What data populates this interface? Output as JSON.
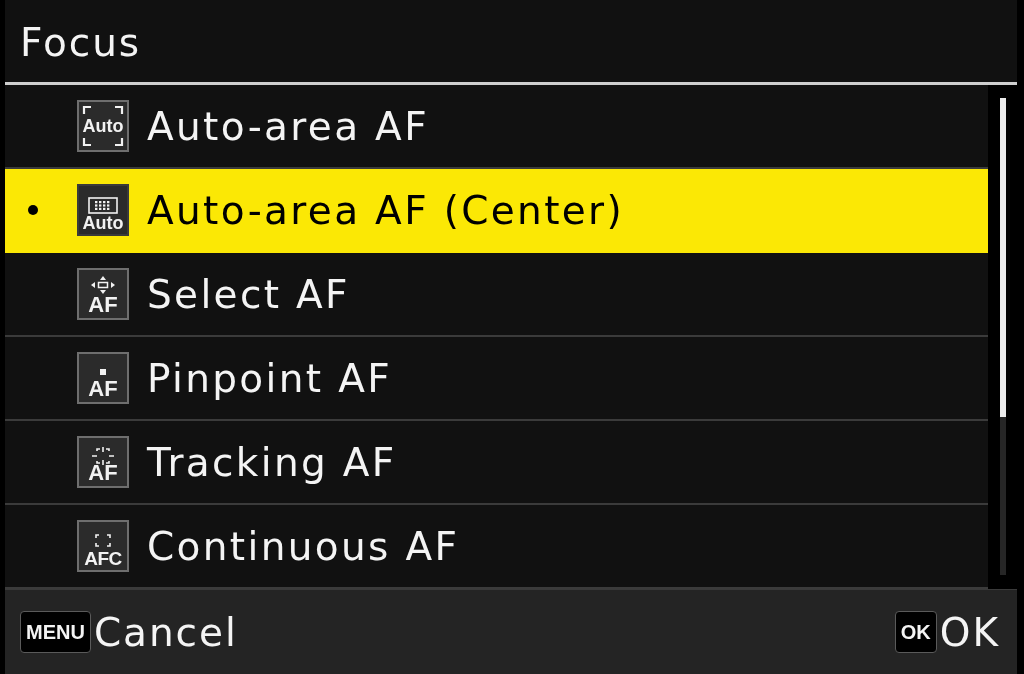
{
  "header": {
    "title": "Focus"
  },
  "items": [
    {
      "label": "Auto-area AF",
      "icon": {
        "kind": "auto-frame",
        "text": "Auto"
      },
      "selected": false,
      "current": false
    },
    {
      "label": "Auto-area AF (Center)",
      "icon": {
        "kind": "auto-grid",
        "text": "Auto"
      },
      "selected": true,
      "current": true
    },
    {
      "label": "Select AF",
      "icon": {
        "kind": "select",
        "text": "AF"
      },
      "selected": false,
      "current": false
    },
    {
      "label": "Pinpoint AF",
      "icon": {
        "kind": "pinpoint",
        "text": "AF"
      },
      "selected": false,
      "current": false
    },
    {
      "label": "Tracking AF",
      "icon": {
        "kind": "tracking",
        "text": "AF"
      },
      "selected": false,
      "current": false
    },
    {
      "label": "Continuous AF",
      "icon": {
        "kind": "continuous",
        "text": "AFC"
      },
      "selected": false,
      "current": false
    }
  ],
  "footer": {
    "hints": [
      {
        "key": "MENU",
        "label": "Cancel"
      },
      {
        "key": "OK",
        "label": "OK"
      }
    ]
  }
}
